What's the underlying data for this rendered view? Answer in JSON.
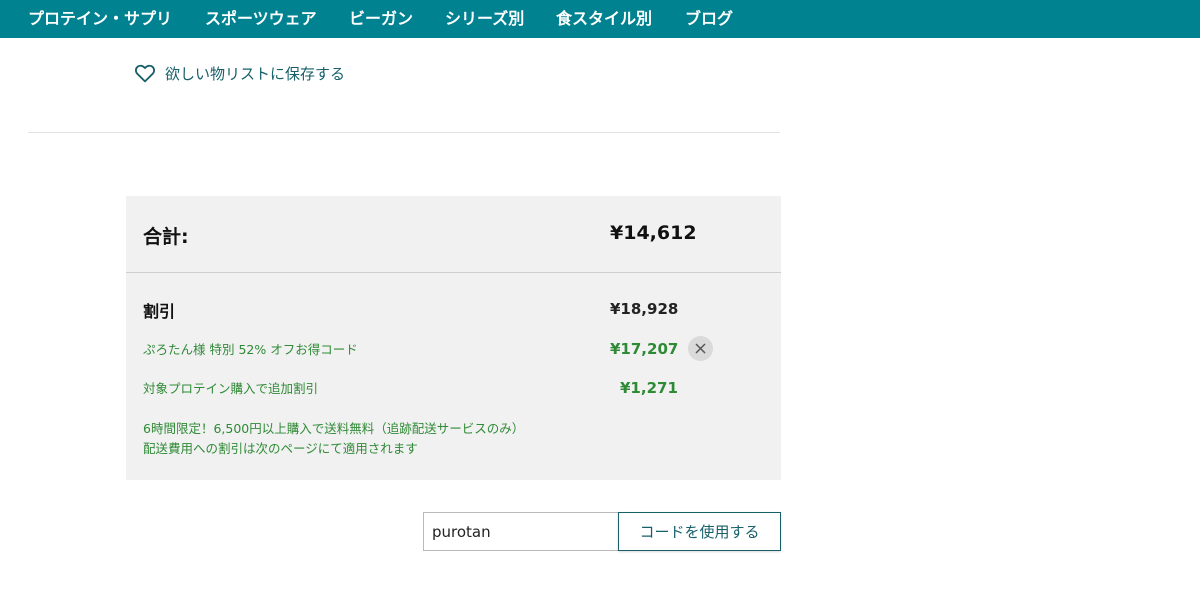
{
  "nav": {
    "items": [
      "プロテイン・サプリ",
      "スポーツウェア",
      "ビーガン",
      "シリーズ別",
      "食スタイル別",
      "ブログ"
    ]
  },
  "wishlist": {
    "label": "欲しい物リストに保存する"
  },
  "summary": {
    "total_label": "合計:",
    "total_value": "¥14,612",
    "discount_label": "割引",
    "discount_value": "¥18,928",
    "lines": [
      {
        "label": "ぷろたん様 特別 52% オフお得コード",
        "amount": "¥17,207"
      },
      {
        "label": "対象プロテイン購入で追加割引",
        "amount": "¥1,271"
      }
    ],
    "shipping_note_1": "6時間限定！6,500円以上購入で送料無料（追跡配送サービスのみ）",
    "shipping_note_2": "配送費用への割引は次のページにて適用されます"
  },
  "promo": {
    "input_value": "purotan",
    "apply_label": "コードを使用する"
  },
  "colors": {
    "nav_bg": "#008290",
    "accent": "#17606a",
    "discount_green": "#2f8a36",
    "summary_bg": "#f1f1f1"
  },
  "icons": {
    "wishlist": "heart-outline-icon",
    "remove": "close-icon"
  }
}
